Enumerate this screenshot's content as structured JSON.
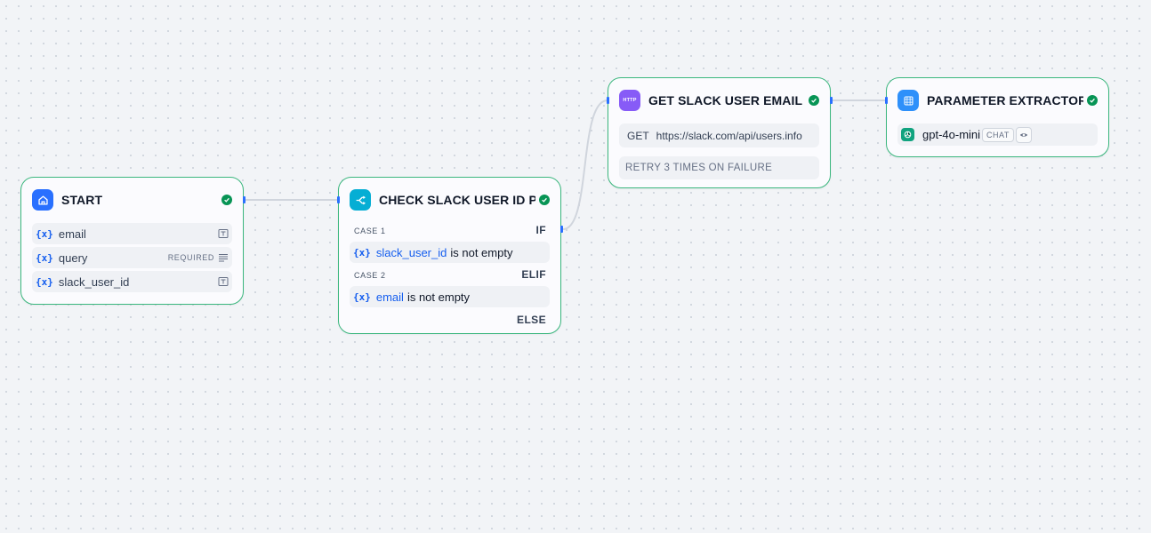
{
  "nodes": {
    "start": {
      "title": "START",
      "icon": "home-icon",
      "variables": [
        {
          "symbol": "{x}",
          "name": "email",
          "badge": "",
          "type_icon": "text-input-icon"
        },
        {
          "symbol": "{x}",
          "name": "query",
          "badge": "REQUIRED",
          "type_icon": "paragraph-icon"
        },
        {
          "symbol": "{x}",
          "name": "slack_user_id",
          "badge": "",
          "type_icon": "text-input-icon"
        }
      ]
    },
    "check": {
      "title": "CHECK SLACK USER ID PRES",
      "icon": "branch-icon",
      "case1_label": "CASE 1",
      "case1_kw": "IF",
      "case1_symbol": "{x}",
      "case1_var": "slack_user_id",
      "case1_op": "is not empty",
      "case2_label": "CASE 2",
      "case2_kw": "ELIF",
      "case2_symbol": "{x}",
      "case2_var": "email",
      "case2_op": "is not empty",
      "else_kw": "ELSE"
    },
    "http": {
      "title": "GET SLACK USER EMAIL",
      "icon": "http-icon",
      "icon_text": "HTTP",
      "method": "GET",
      "url": "https://slack.com/api/users.info",
      "retry": "RETRY 3 TIMES ON FAILURE"
    },
    "extractor": {
      "title": "PARAMETER EXTRACTOR",
      "icon": "parameter-extractor-icon",
      "model_icon": "openai-icon",
      "model": "gpt-4o-mini",
      "mode": "CHAT",
      "view_icon": "eye-icon"
    }
  },
  "colors": {
    "canvas": "#f2f4f7",
    "node_border": "#3bb77e",
    "success": "#079455",
    "accent": "#155eef",
    "handle": "#2970ff",
    "start_icon": "#2970ff",
    "branch_icon": "#06aed4",
    "http_icon": "#875bf7",
    "extractor_icon": "#2e90fa"
  }
}
